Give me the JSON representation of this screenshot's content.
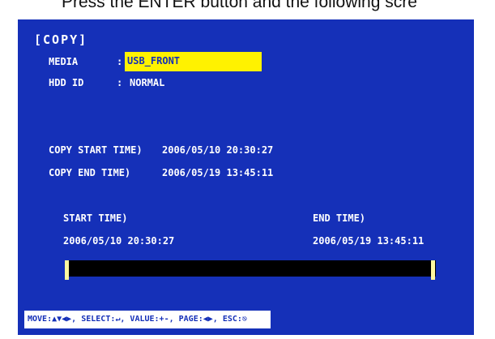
{
  "caption": "Press the ENTER button and the following scre",
  "menu": {
    "title": "[COPY]",
    "media_label": "MEDIA",
    "media_sep": ":",
    "media_value": "USB_FRONT",
    "hdd_label": "HDD ID",
    "hdd_sep": ":",
    "hdd_value": "NORMAL",
    "copy_start_label": "COPY START TIME)",
    "copy_start_value": "2006/05/10 20:30:27",
    "copy_end_label": "COPY END   TIME)",
    "copy_end_value": "2006/05/19 13:45:11",
    "start_label": "START TIME)",
    "start_value": "2006/05/10 20:30:27",
    "end_label": "END   TIME)",
    "end_value": "2006/05/19 13:45:11"
  },
  "help": "MOVE:▲▼◀▶, SELECT:↵, VALUE:+-, PAGE:◀▶, ESC:⎋",
  "colors": {
    "background": "#1530b8",
    "highlight": "#fff200",
    "text": "#ffffff"
  }
}
